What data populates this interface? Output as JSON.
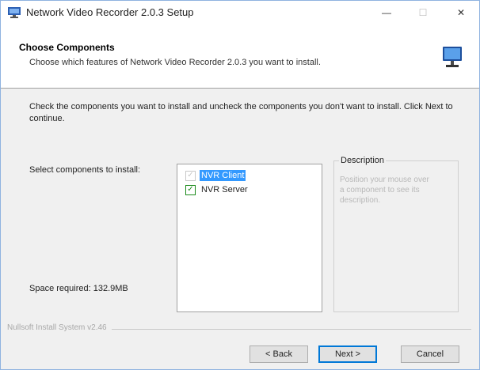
{
  "window": {
    "title": "Network Video Recorder 2.0.3 Setup",
    "minimize_glyph": "—",
    "maximize_glyph": "☐",
    "close_glyph": "✕"
  },
  "header": {
    "title": "Choose Components",
    "subtitle": "Choose which features of Network Video Recorder 2.0.3 you want to install.",
    "icon": "monitor-icon"
  },
  "body": {
    "intro": "Check the components you want to install and uncheck the components you don't want to install. Click Next to continue.",
    "select_label": "Select components to install:",
    "space_label": "Space required: 132.9MB",
    "components": [
      {
        "label": "NVR Client",
        "checked": true,
        "selected": true,
        "disabled": true
      },
      {
        "label": "NVR Server",
        "checked": true,
        "selected": false,
        "disabled": false
      }
    ],
    "description": {
      "legend": "Description",
      "text": "Position your mouse over a component to see its description."
    }
  },
  "footer": {
    "branding": "Nullsoft Install System v2.46",
    "back_label": "< Back",
    "next_label": "Next >",
    "cancel_label": "Cancel"
  },
  "colors": {
    "selection": "#3399ff",
    "default_button_border": "#0078d7",
    "checkmark": "#1a8a1a"
  }
}
